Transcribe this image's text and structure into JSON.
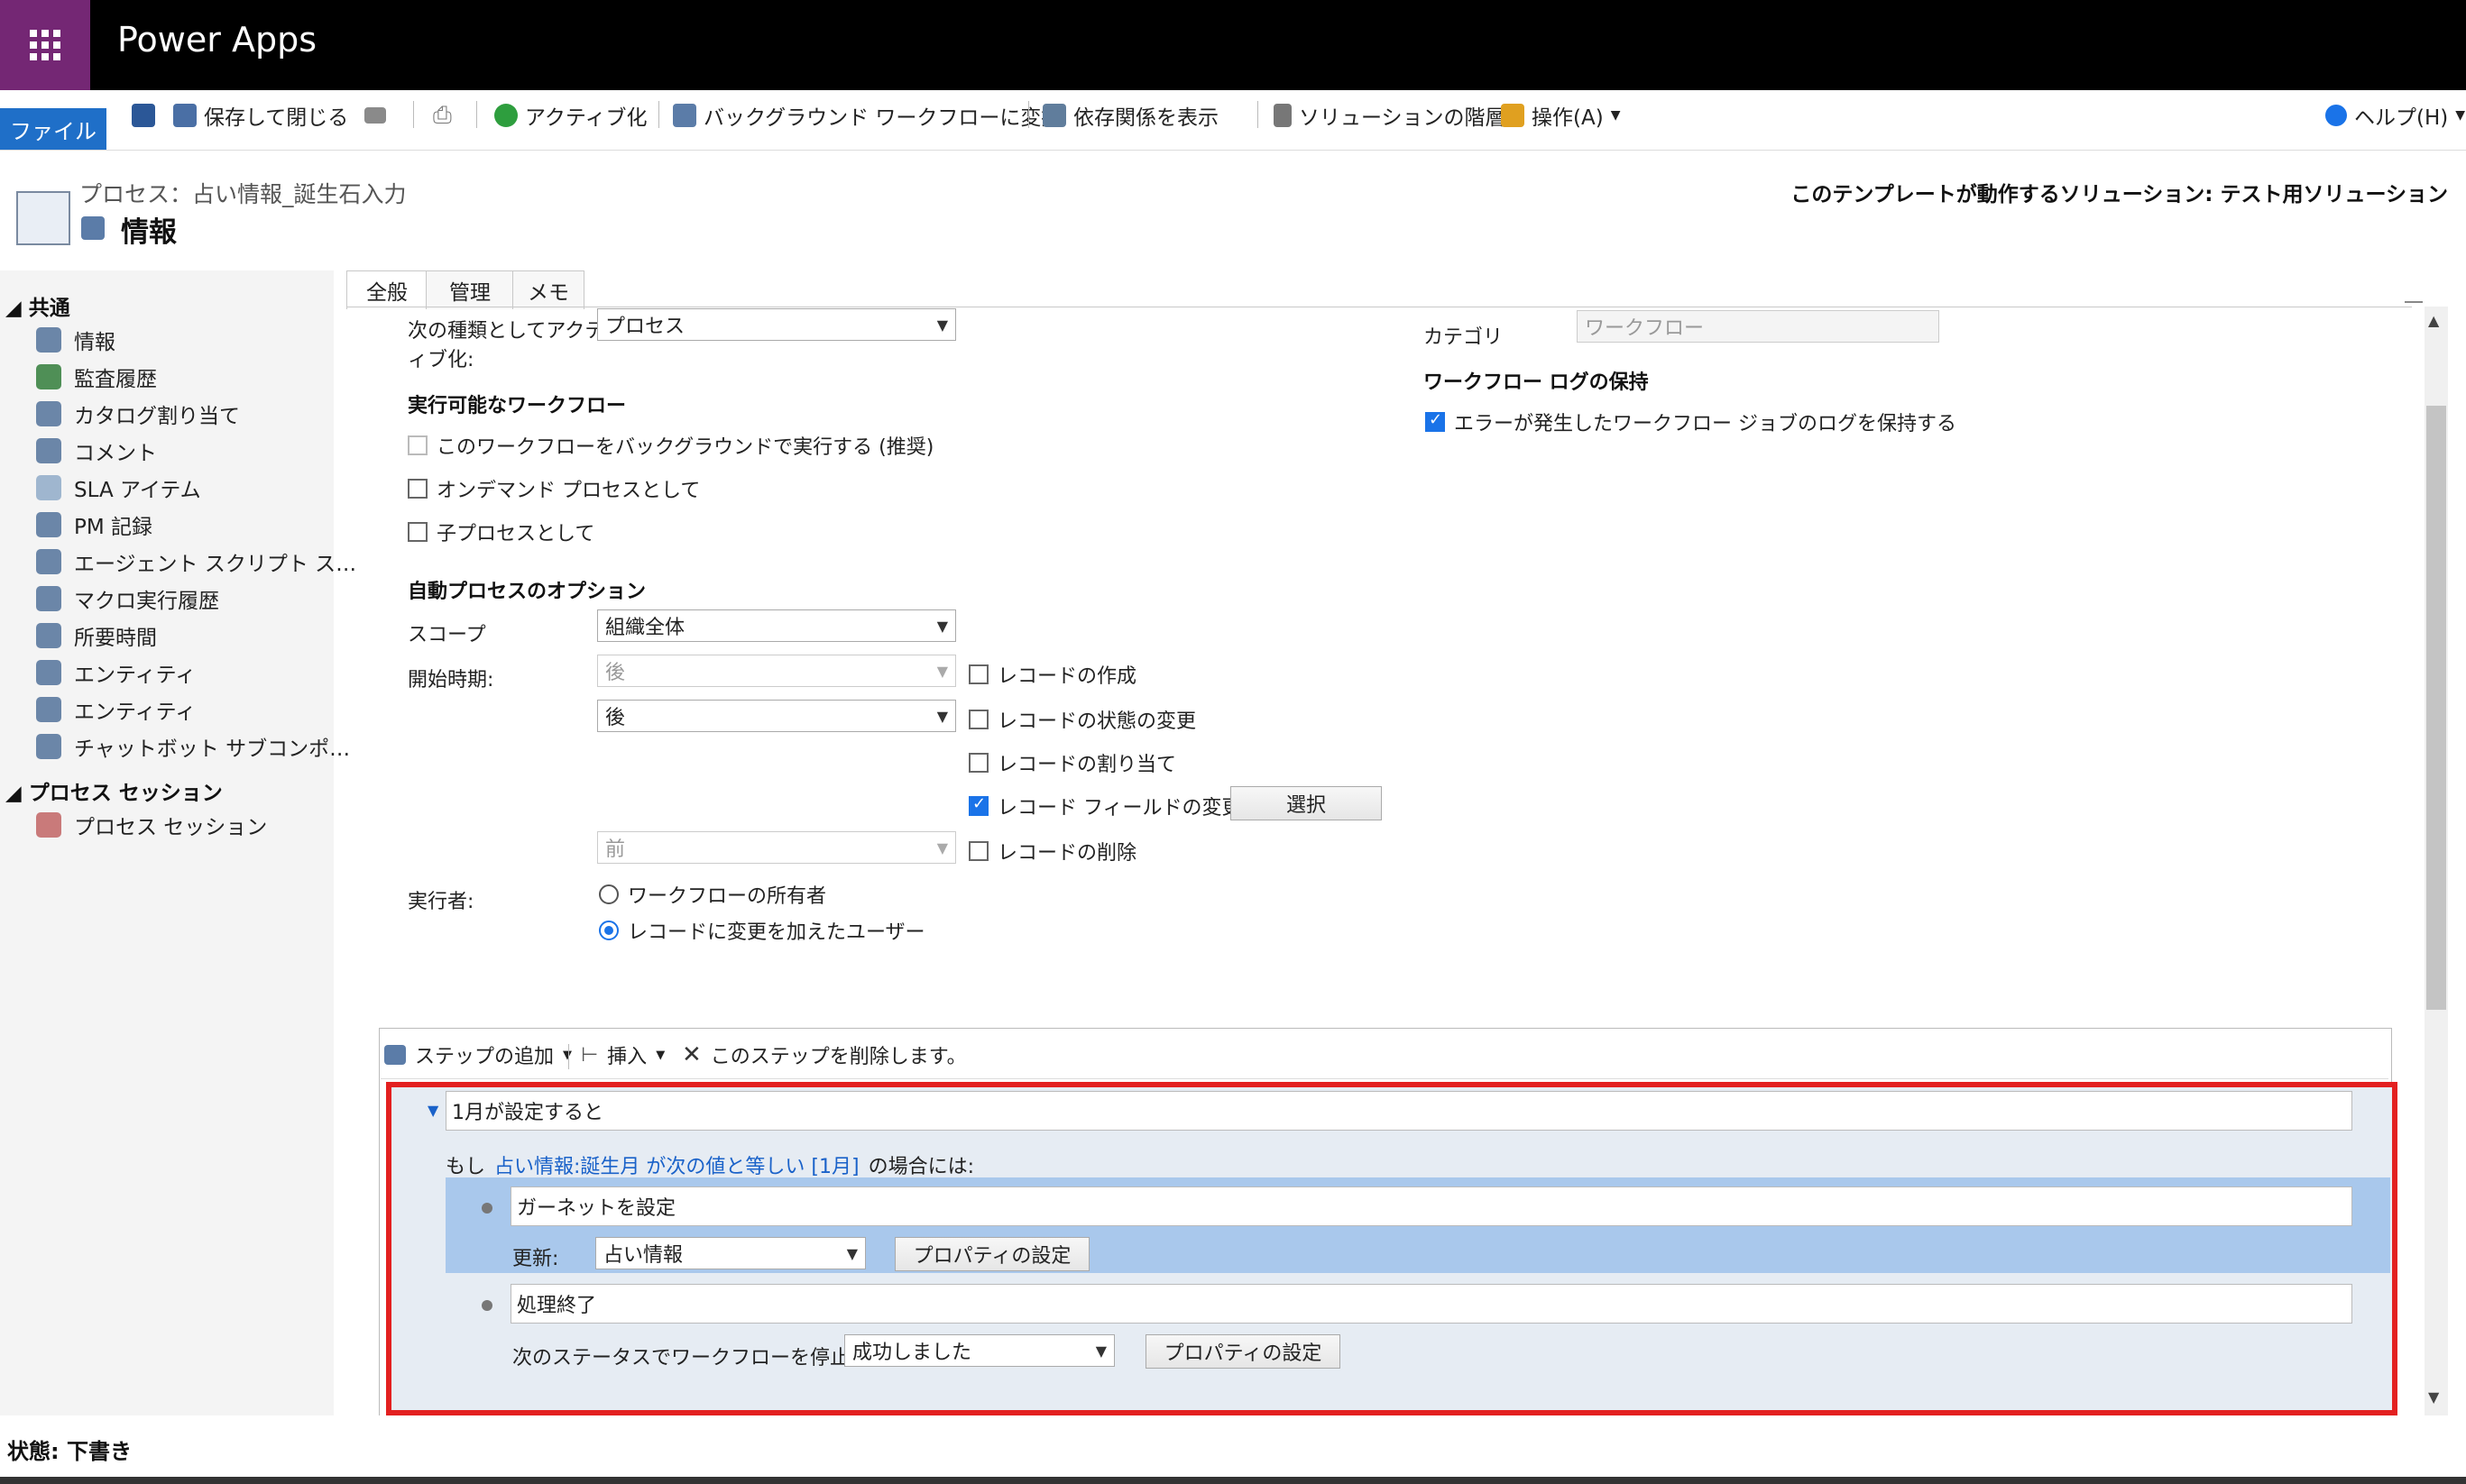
{
  "app": {
    "title": "Power Apps"
  },
  "toolbar": {
    "file": "ファイル",
    "save_close": "保存して閉じる",
    "activate": "アクティブ化",
    "convert_bg": "バックグラウンド ワークフローに変換",
    "show_deps": "依存関係を表示",
    "solution_layers": "ソリューションの階層",
    "actions": "操作(A)",
    "help": "ヘルプ(H)"
  },
  "header": {
    "breadcrumb": "プロセス：占い情報_誕生石入力",
    "title": "情報",
    "solution": "このテンプレートが動作するソリューション: テスト用ソリューション"
  },
  "nav": {
    "section1": "共通",
    "items1": [
      "情報",
      "監査履歴",
      "カタログ割り当て",
      "コメント",
      "SLA アイテム",
      "PM 記録",
      "エージェント スクリプト ス…",
      "マクロ実行履歴",
      "所要時間",
      "エンティティ",
      "エンティティ",
      "チャットボット サブコンポ…"
    ],
    "section2": "プロセス セッション",
    "items2": [
      "プロセス セッション"
    ]
  },
  "tabs": [
    "全般",
    "管理",
    "メモ"
  ],
  "form": {
    "activate_as_label": "次の種類としてアクティブ化:",
    "activate_as_label_l1": "次の種類としてアクテ",
    "activate_as_label_l2": "ィブ化:",
    "activate_as_value": "プロセス",
    "runnable_header": "実行可能なワークフロー",
    "run_bg": "このワークフローをバックグラウンドで実行する (推奨)",
    "on_demand": "オンデマンド プロセスとして",
    "child_process": "子プロセスとして",
    "auto_header": "自動プロセスのオプション",
    "scope_label": "スコープ",
    "scope_value": "組織全体",
    "start_label": "開始時期:",
    "start_after_disabled": "後",
    "start_after": "後",
    "start_before_disabled": "前",
    "rec_create": "レコードの作成",
    "rec_status": "レコードの状態の変更",
    "rec_assign": "レコードの割り当て",
    "rec_field": "レコード フィールドの変更",
    "select_btn": "選択",
    "rec_delete": "レコードの削除",
    "runas_label": "実行者:",
    "runas_owner": "ワークフローの所有者",
    "runas_user": "レコードに変更を加えたユーザー",
    "category_label": "カテゴリ",
    "category_value": "ワークフロー",
    "log_header": "ワークフロー ログの保持",
    "log_keep": "エラーが発生したワークフロー ジョブのログを保持する"
  },
  "steps": {
    "add_step": "ステップの追加",
    "insert": "挿入",
    "delete_step": "このステップを削除します。",
    "condition_title": "1月が設定すると",
    "if_prefix": "もし",
    "if_condition": "占い情報:誕生月 が次の値と等しい [1月]",
    "if_suffix": "の場合には:",
    "step1_title": "ガーネットを設定",
    "update_label": "更新:",
    "update_value": "占い情報",
    "set_props": "プロパティの設定",
    "step2_title": "処理終了",
    "stop_label": "次のステータスでワークフローを停止:",
    "stop_value": "成功しました",
    "set_props2": "プロパティの設定"
  },
  "status": {
    "text": "状態: 下書き"
  }
}
